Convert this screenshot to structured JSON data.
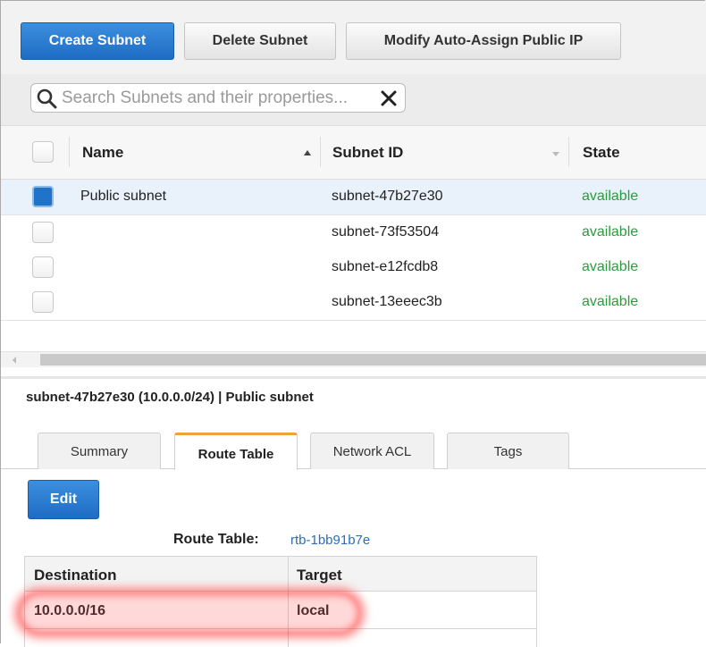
{
  "toolbar": {
    "create_label": "Create Subnet",
    "delete_label": "Delete Subnet",
    "modify_label": "Modify Auto-Assign Public IP"
  },
  "search": {
    "placeholder": "Search Subnets and their properties..."
  },
  "table": {
    "columns": [
      "Name",
      "Subnet ID",
      "State"
    ],
    "rows": [
      {
        "name": "Public subnet",
        "subnet_id": "subnet-47b27e30",
        "state": "available",
        "selected": true
      },
      {
        "name": "",
        "subnet_id": "subnet-73f53504",
        "state": "available",
        "selected": false
      },
      {
        "name": "",
        "subnet_id": "subnet-e12fcdb8",
        "state": "available",
        "selected": false
      },
      {
        "name": "",
        "subnet_id": "subnet-13eeec3b",
        "state": "available",
        "selected": false
      }
    ]
  },
  "detail": {
    "title": "subnet-47b27e30 (10.0.0.0/24) | Public subnet",
    "tabs": [
      "Summary",
      "Route Table",
      "Network ACL",
      "Tags"
    ],
    "active_tab": "Route Table",
    "edit_label": "Edit",
    "route_table_label": "Route Table:",
    "route_table_id": "rtb-1bb91b7e",
    "routes": {
      "headers": [
        "Destination",
        "Target"
      ],
      "rows": [
        {
          "destination": "10.0.0.0/16",
          "target": "local"
        }
      ]
    }
  },
  "colors": {
    "primary_button": "#1e6cc4",
    "state_available": "#2e9a3e",
    "active_tab_accent": "#f0a03c",
    "link": "#2b6ebb",
    "highlight": "#ff2828"
  }
}
